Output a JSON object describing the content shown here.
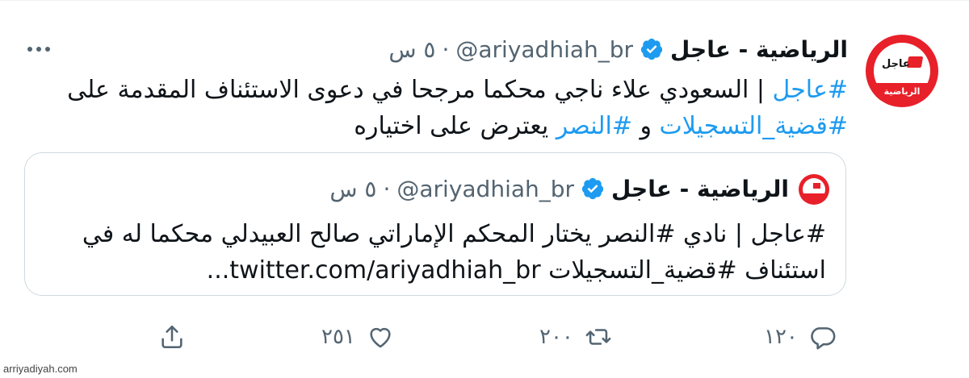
{
  "tweet": {
    "author_name": "الرياضية - عاجل",
    "handle": "@ariyadhiah_br",
    "dot": "·",
    "time": "٥ س",
    "avatar": {
      "logo_text": "عاجل",
      "label": "الرياضية"
    },
    "body_lines": [
      [
        {
          "text": "#عاجل",
          "link": true
        },
        {
          "text": " | السعودي علاء ناجي محكما مرجحا في دعوى الاستئناف المقدمة على",
          "link": false
        }
      ],
      [
        {
          "text": "#قضية_التسجيلات",
          "link": true
        },
        {
          "text": " و ",
          "link": false
        },
        {
          "text": "#النصر",
          "link": true
        },
        {
          "text": " يعترض على اختياره",
          "link": false
        }
      ]
    ]
  },
  "quoted": {
    "author_name": "الرياضية - عاجل",
    "handle": "@ariyadhiah_br",
    "dot": "·",
    "time": "٥ س",
    "line1": "#عاجل | نادي #النصر يختار المحكم الإماراتي صالح العبيدلي محكما له في",
    "line2": "استئناف #قضية_التسجيلات twitter.com/ariyadhiah_br..."
  },
  "actions": {
    "reply": {
      "icon": "reply-icon",
      "count": "١٢٠"
    },
    "retweet": {
      "icon": "retweet-icon",
      "count": "٢٠٠"
    },
    "like": {
      "icon": "heart-icon",
      "count": "٢٥١"
    },
    "share": {
      "icon": "share-icon"
    }
  },
  "watermark": "arriyadiyah.com",
  "colors": {
    "link": "#1d9bf0",
    "verified": "#1d9bf0",
    "muted": "#536471",
    "brand": "#e8202a"
  }
}
